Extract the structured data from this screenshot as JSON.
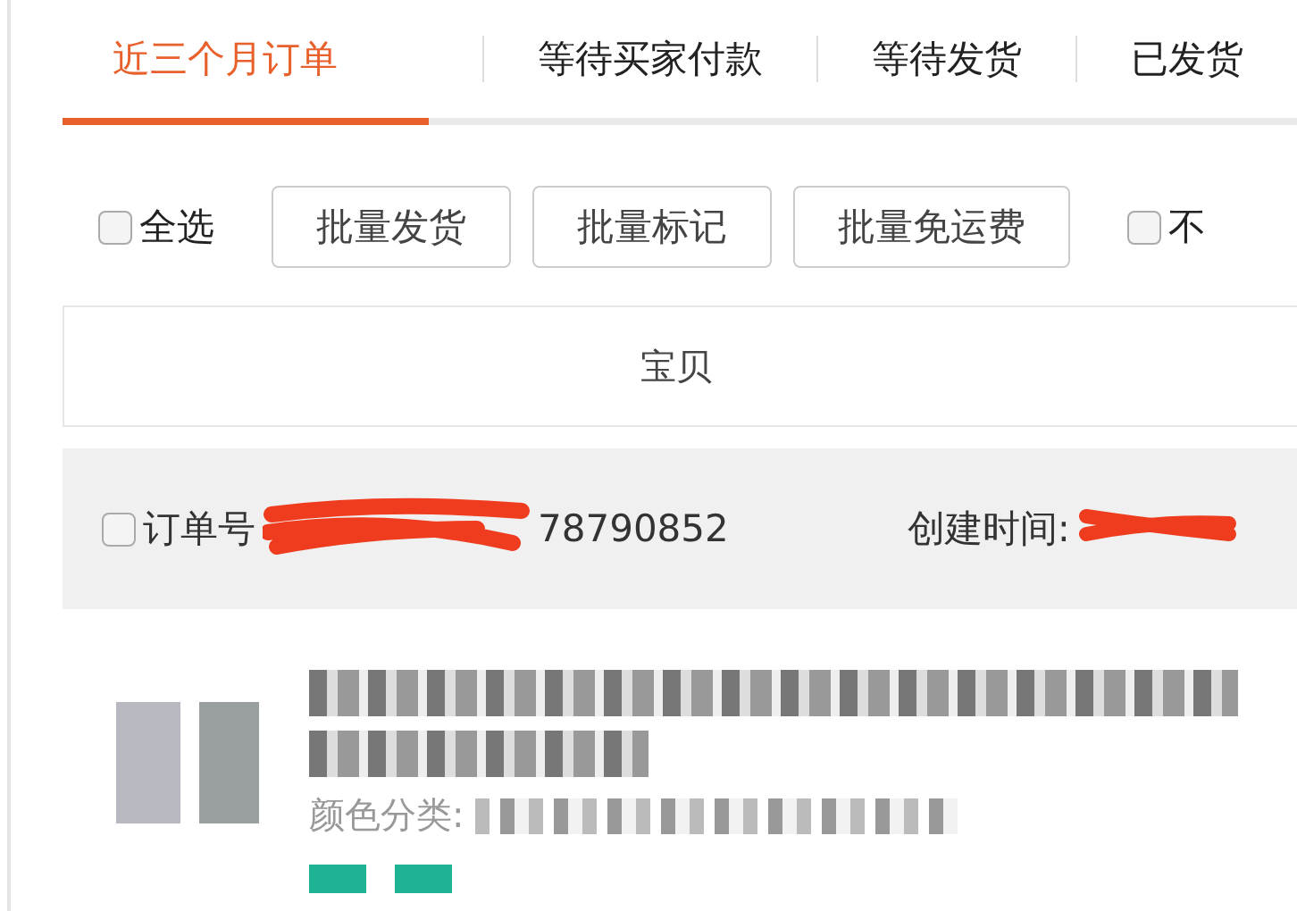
{
  "tabs": [
    {
      "label": "近三个月订单",
      "selected": true
    },
    {
      "label": "等待买家付款",
      "selected": false
    },
    {
      "label": "等待发货",
      "selected": false
    },
    {
      "label": "已发货",
      "selected": false
    }
  ],
  "toolbar": {
    "select_all": {
      "label": "全选",
      "checked": false
    },
    "buttons": [
      "批量发货",
      "批量标记",
      "批量免运费"
    ],
    "extra_checkbox": {
      "label": "不",
      "checked": false
    }
  },
  "table": {
    "columns": [
      "宝贝"
    ]
  },
  "order": {
    "checked": false,
    "number_label": "订单号",
    "number_visible": "78790852",
    "created_label": "创建时间:",
    "item": {
      "color_label": "颜色分类:"
    }
  }
}
